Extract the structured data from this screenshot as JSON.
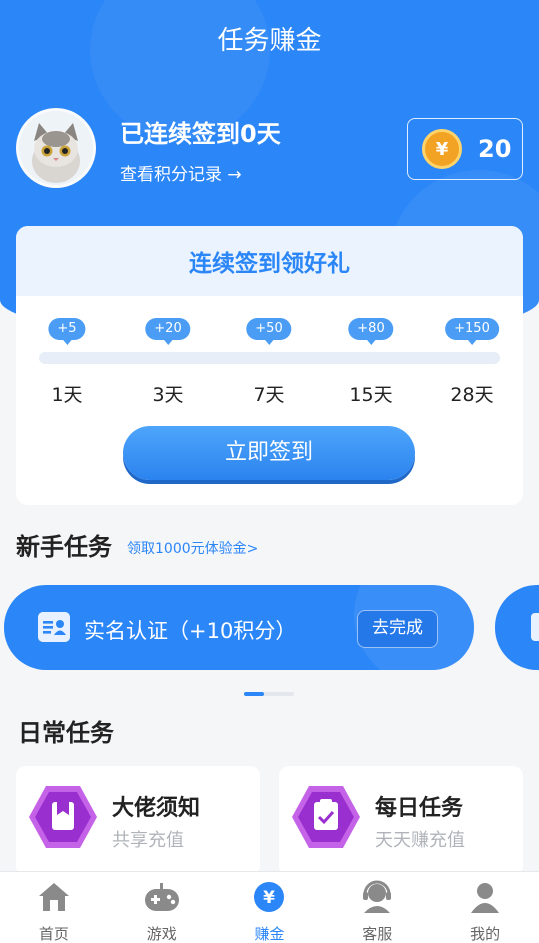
{
  "header": {
    "title": "任务赚金"
  },
  "user": {
    "streak_text": "已连续签到0天",
    "points_link": "查看积分记录 →",
    "coins": "20",
    "coin_symbol": "¥"
  },
  "checkin": {
    "title": "连续签到领好礼",
    "rewards": [
      "+5",
      "+20",
      "+50",
      "+80",
      "+150"
    ],
    "days": [
      "1天",
      "3天",
      "7天",
      "15天",
      "28天"
    ],
    "progress": 0,
    "button": "立即签到"
  },
  "newbie": {
    "title": "新手任务",
    "link": "领取1000元体验金>",
    "task_text": "实名认证（+10积分）",
    "task_button": "去完成",
    "page_indicator": {
      "current": 1
    }
  },
  "daily": {
    "title": "日常任务",
    "cards": [
      {
        "title": "大佬须知",
        "sub": "共享充值",
        "icon": "bookmark-icon"
      },
      {
        "title": "每日任务",
        "sub": "天天赚充值",
        "icon": "clipboard-check-icon"
      }
    ]
  },
  "tabs": [
    {
      "label": "首页",
      "icon": "home-icon"
    },
    {
      "label": "游戏",
      "icon": "gamepad-icon"
    },
    {
      "label": "赚金",
      "icon": "yen-icon",
      "active": true
    },
    {
      "label": "客服",
      "icon": "support-icon"
    },
    {
      "label": "我的",
      "icon": "user-icon"
    }
  ],
  "colors": {
    "primary": "#2b86f7",
    "hex_purple": "#b64ad8",
    "coin": "#f3a324"
  }
}
